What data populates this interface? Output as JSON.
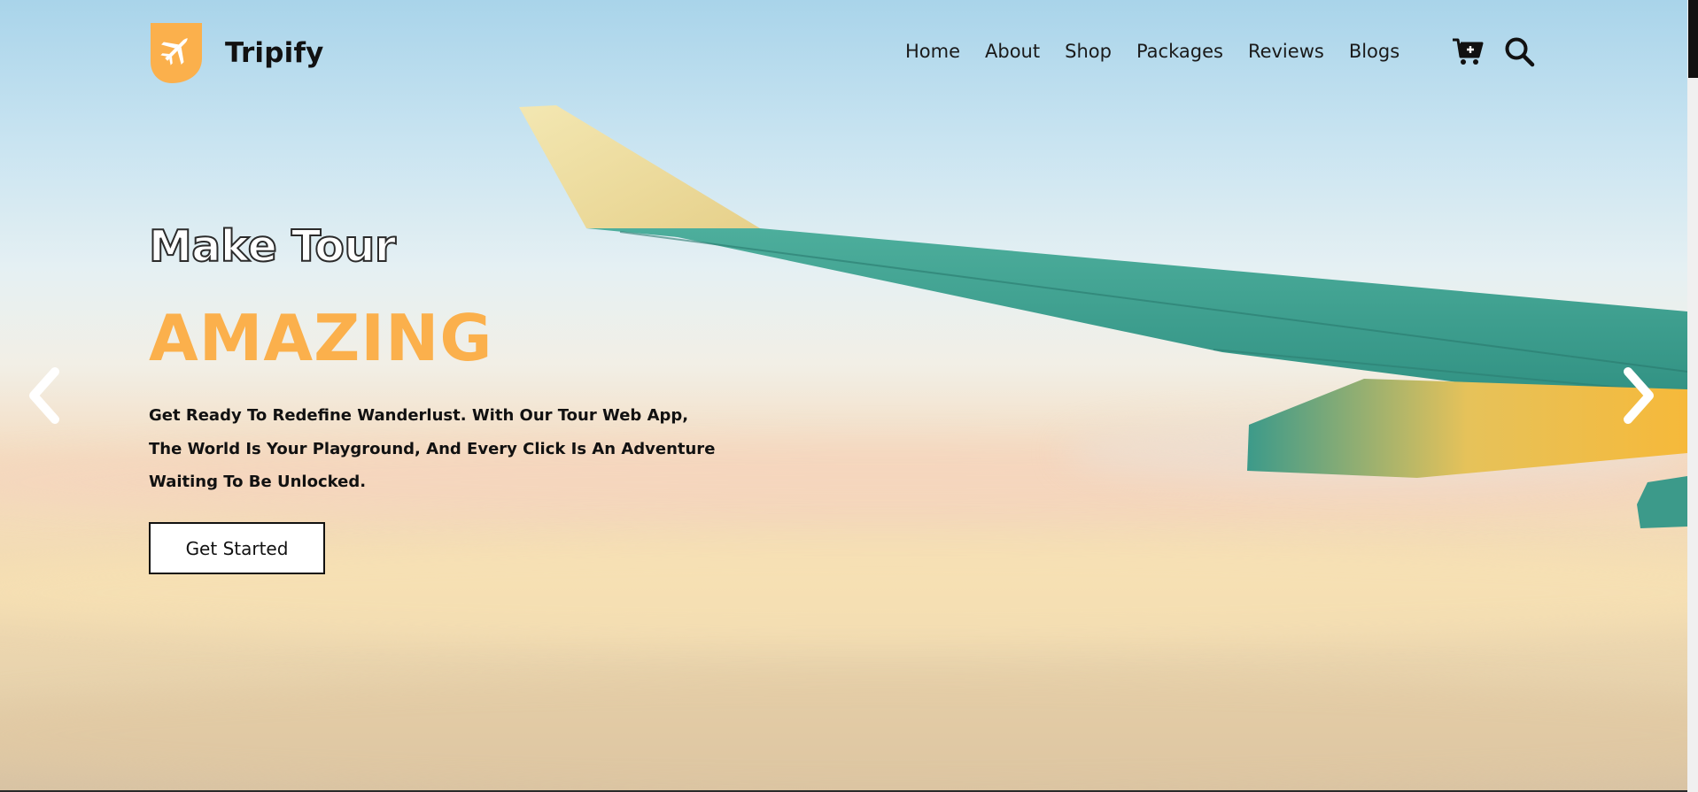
{
  "brand": {
    "name": "Tripify",
    "logo_icon": "airplane-shield-icon",
    "accent": "#fbb04c"
  },
  "nav": {
    "items": [
      {
        "label": "Home"
      },
      {
        "label": "About"
      },
      {
        "label": "Shop"
      },
      {
        "label": "Packages"
      },
      {
        "label": "Reviews"
      },
      {
        "label": "Blogs"
      }
    ],
    "icons": [
      "cart-icon",
      "search-icon"
    ]
  },
  "hero": {
    "title_small": "Make Tour",
    "title_big": "AMAZING",
    "title_big_color": "#fbb04c",
    "description": "Get Ready To Redefine Wanderlust. With Our Tour Web App, The World Is Your Playground, And Every Click Is An Adventure Waiting To Be Unlocked.",
    "cta_label": "Get Started",
    "prev_icon": "chevron-left-icon",
    "next_icon": "chevron-right-icon"
  }
}
